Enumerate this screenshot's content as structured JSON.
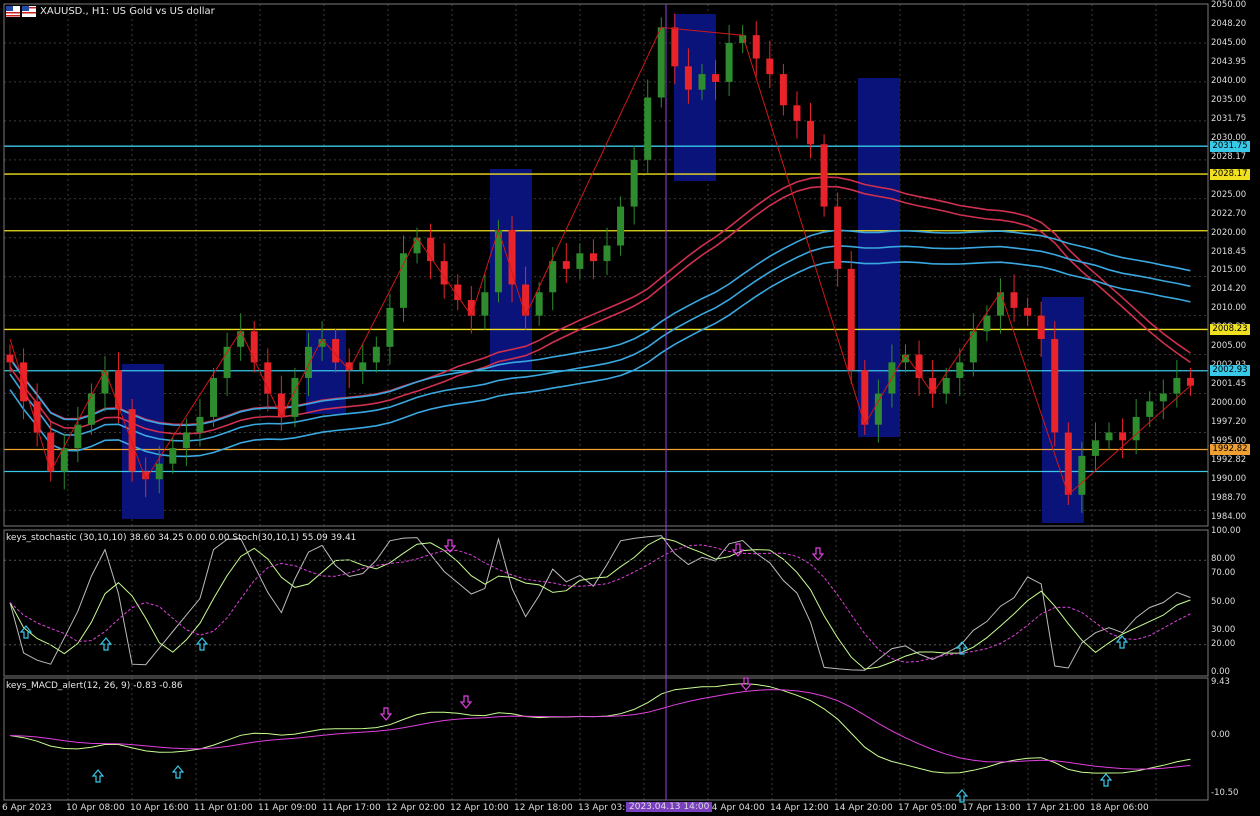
{
  "window": {
    "title": "XAUUSD., H1:  US Gold vs US dollar"
  },
  "colors": {
    "bg": "#000000",
    "grid": "#3a3a3a",
    "bull": "#2e8b2e",
    "bear": "#e8242a",
    "zigzag": "#d01818",
    "cyan": "#38c8e8",
    "yellow": "#f0e020",
    "orange": "#f0a030",
    "box": "#0a1480",
    "ma_red": "#d03050",
    "ma_blue": "#3aa8e0",
    "magenta": "#e040e0",
    "crosshair": "#9a40e0"
  },
  "price_axis": {
    "labels": [
      "2050.00",
      "2048.20",
      "2045.00",
      "2043.95",
      "2040.00",
      "2035.00",
      "2031.75",
      "2030.00",
      "2028.17",
      "2026.95",
      "2025.00",
      "2022.70",
      "2020.00",
      "2018.45",
      "2015.00",
      "2014.20",
      "2010.00",
      "2008.23",
      "2005.00",
      "2002.93",
      "2001.45",
      "2000.00",
      "1997.20",
      "1995.00",
      "1992.82",
      "1990.00",
      "1988.70",
      "1984.00"
    ],
    "tags": [
      {
        "value": "2031.75",
        "color": "cyan"
      },
      {
        "value": "2028.17",
        "color": "yellow"
      },
      {
        "value": "2008.23",
        "color": "yellow"
      },
      {
        "value": "2002.93",
        "color": "cyan"
      },
      {
        "value": "1992.82",
        "color": "orange"
      }
    ],
    "hlines": [
      {
        "price": 2031.75,
        "color": "cyan"
      },
      {
        "price": 2028.17,
        "color": "yellow"
      },
      {
        "price": 2020.9,
        "color": "yellow"
      },
      {
        "price": 2008.23,
        "color": "yellow"
      },
      {
        "price": 2002.93,
        "color": "cyan"
      },
      {
        "price": 1992.82,
        "color": "orange"
      },
      {
        "price": 1990.0,
        "color": "cyan"
      }
    ]
  },
  "stoch": {
    "title": "keys_stochastic (30,10,10) 38.60 34.25 0.00 0.00 Stoch(30,10,1) 55.09 39.41",
    "levels": [
      "100.00",
      "80.00",
      "70.00",
      "50.00",
      "30.00",
      "20.00",
      "0.00"
    ]
  },
  "macd": {
    "title": "keys_MACD_alert(12, 26, 9) -0.83 -0.86",
    "levels": [
      "9.43",
      "0.00",
      "-10.50"
    ]
  },
  "time_axis": {
    "labels": [
      "6 Apr 2023",
      "10 Apr 08:00",
      "10 Apr 16:00",
      "11 Apr 01:00",
      "11 Apr 09:00",
      "11 Apr 17:00",
      "12 Apr 02:00",
      "12 Apr 10:00",
      "12 Apr 18:00",
      "13 Apr 03:00",
      "13 Apr 19:00",
      "14 Apr 04:00",
      "14 Apr 12:00",
      "14 Apr 20:00",
      "17 Apr 05:00",
      "17 Apr 13:00",
      "17 Apr 21:00",
      "18 Apr 06:00"
    ],
    "cursor_label": "2023.04.13 14:00"
  },
  "chart_data": {
    "type": "candlestick",
    "symbol": "XAUUSD.",
    "timeframe": "H1",
    "ylim": [
      1983,
      2050
    ],
    "closes": [
      2004,
      1999,
      1995,
      1990,
      1993,
      1996,
      2000,
      2003,
      1998,
      1990,
      1989,
      1991,
      1993,
      1995,
      1997,
      2002,
      2006,
      2008,
      2004,
      2000,
      1997,
      2002,
      2006,
      2007,
      2004,
      2003,
      2004,
      2006,
      2011,
      2018,
      2020,
      2017,
      2014,
      2012,
      2010,
      2013,
      2021,
      2014,
      2010,
      2013,
      2017,
      2016,
      2018,
      2017,
      2019,
      2024,
      2030,
      2038,
      2047,
      2042,
      2039,
      2041,
      2040,
      2045,
      2046,
      2043,
      2041,
      2037,
      2035,
      2032,
      2024,
      2016,
      2003,
      1996,
      2000,
      2004,
      2005,
      2002,
      2000,
      2002,
      2004,
      2008,
      2010,
      2013,
      2011,
      2010,
      2007,
      1995,
      1987,
      1992,
      1994,
      1995,
      1994,
      1997,
      1999,
      2000,
      2002,
      2001
    ],
    "macd_series": [
      "main",
      "signal"
    ],
    "stoch_series": [
      "keys_stochastic",
      "Stoch"
    ]
  }
}
